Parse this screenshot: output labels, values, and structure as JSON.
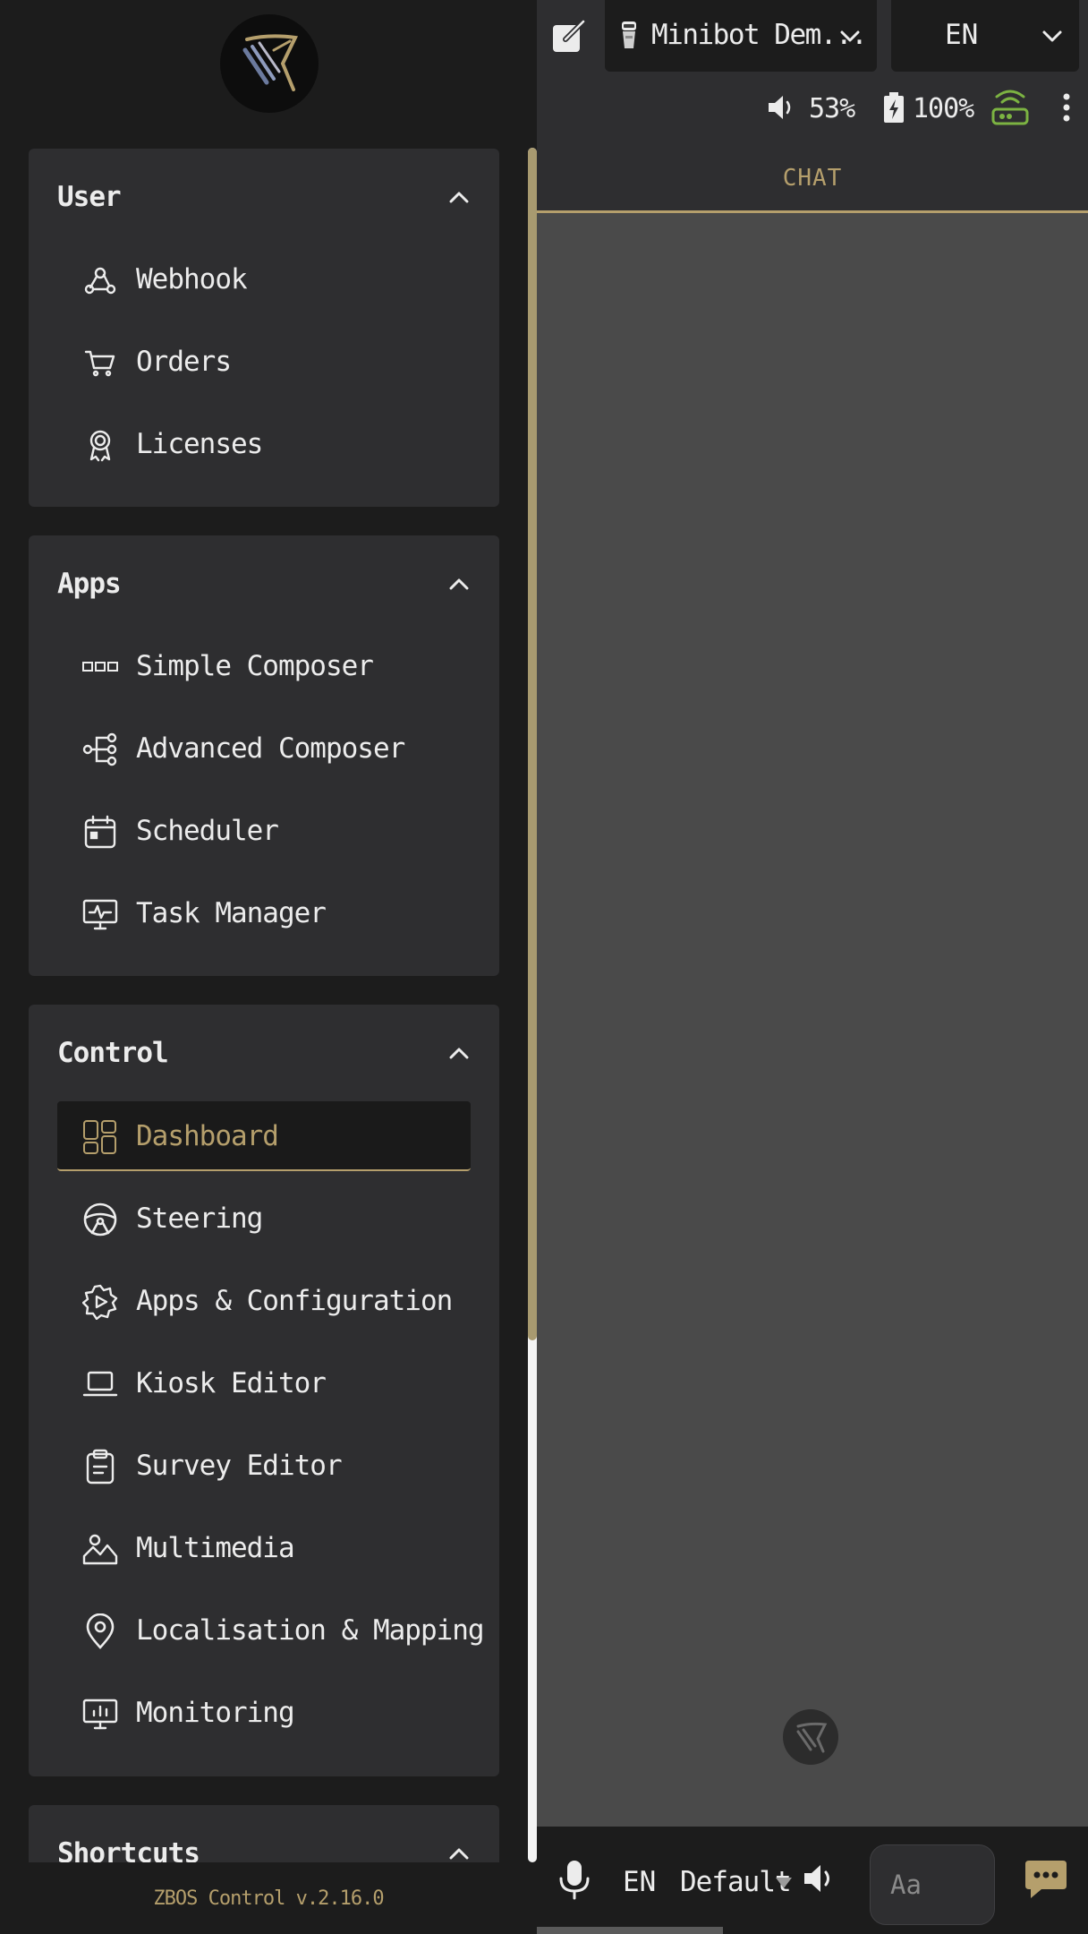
{
  "sidebar": {
    "sections": [
      {
        "title": "User",
        "items": [
          {
            "label": "Webhook",
            "icon": "webhook-icon"
          },
          {
            "label": "Orders",
            "icon": "cart-icon"
          },
          {
            "label": "Licenses",
            "icon": "award-icon"
          }
        ]
      },
      {
        "title": "Apps",
        "items": [
          {
            "label": "Simple Composer",
            "icon": "boxes-icon"
          },
          {
            "label": "Advanced Composer",
            "icon": "flow-icon"
          },
          {
            "label": "Scheduler",
            "icon": "calendar-icon"
          },
          {
            "label": "Task Manager",
            "icon": "monitor-pulse-icon"
          }
        ]
      },
      {
        "title": "Control",
        "items": [
          {
            "label": "Dashboard",
            "icon": "dashboard-icon",
            "active": true
          },
          {
            "label": "Steering",
            "icon": "steering-wheel-icon"
          },
          {
            "label": "Apps & Configuration",
            "icon": "gear-play-icon"
          },
          {
            "label": "Kiosk Editor",
            "icon": "laptop-icon"
          },
          {
            "label": "Survey Editor",
            "icon": "clipboard-icon"
          },
          {
            "label": "Multimedia",
            "icon": "image-icon"
          },
          {
            "label": "Localisation & Mapping",
            "icon": "map-pin-icon"
          },
          {
            "label": "Monitoring",
            "icon": "monitor-chart-icon"
          }
        ]
      },
      {
        "title": "Shortcuts",
        "items": []
      }
    ],
    "footer": "ZBOS Control   v.2.16.0"
  },
  "topbar": {
    "robot": "Minibot Dem...",
    "language": "EN",
    "volume": "53%",
    "battery": "100%"
  },
  "chat": {
    "tab_label": "CHAT"
  },
  "bottombar": {
    "language": "EN",
    "voice": "Default",
    "input_placeholder": "Aa"
  },
  "colors": {
    "accent": "#b59f6c",
    "wifi": "#7cb342",
    "card": "#2e2e30",
    "background": "#1c1c1c",
    "chat_background": "#4a4a4a"
  }
}
